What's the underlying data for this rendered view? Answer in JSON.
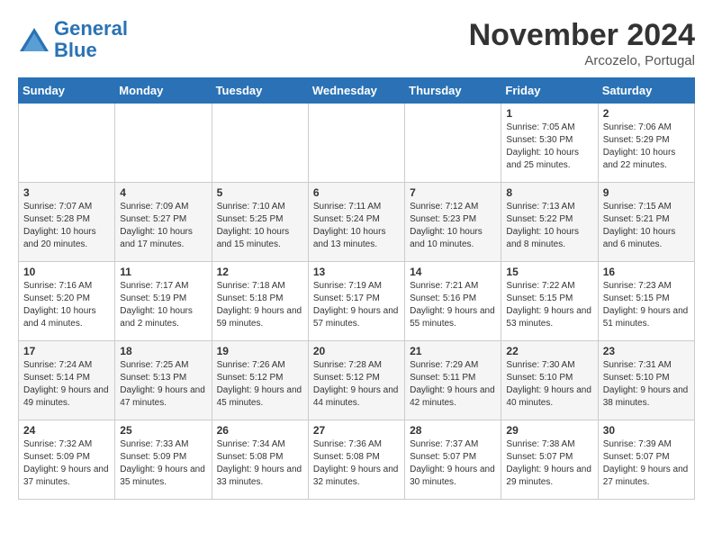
{
  "logo": {
    "line1": "General",
    "line2": "Blue"
  },
  "title": "November 2024",
  "location": "Arcozelo, Portugal",
  "weekdays": [
    "Sunday",
    "Monday",
    "Tuesday",
    "Wednesday",
    "Thursday",
    "Friday",
    "Saturday"
  ],
  "weeks": [
    [
      {
        "day": "",
        "content": ""
      },
      {
        "day": "",
        "content": ""
      },
      {
        "day": "",
        "content": ""
      },
      {
        "day": "",
        "content": ""
      },
      {
        "day": "",
        "content": ""
      },
      {
        "day": "1",
        "content": "Sunrise: 7:05 AM\nSunset: 5:30 PM\nDaylight: 10 hours and 25 minutes."
      },
      {
        "day": "2",
        "content": "Sunrise: 7:06 AM\nSunset: 5:29 PM\nDaylight: 10 hours and 22 minutes."
      }
    ],
    [
      {
        "day": "3",
        "content": "Sunrise: 7:07 AM\nSunset: 5:28 PM\nDaylight: 10 hours and 20 minutes."
      },
      {
        "day": "4",
        "content": "Sunrise: 7:09 AM\nSunset: 5:27 PM\nDaylight: 10 hours and 17 minutes."
      },
      {
        "day": "5",
        "content": "Sunrise: 7:10 AM\nSunset: 5:25 PM\nDaylight: 10 hours and 15 minutes."
      },
      {
        "day": "6",
        "content": "Sunrise: 7:11 AM\nSunset: 5:24 PM\nDaylight: 10 hours and 13 minutes."
      },
      {
        "day": "7",
        "content": "Sunrise: 7:12 AM\nSunset: 5:23 PM\nDaylight: 10 hours and 10 minutes."
      },
      {
        "day": "8",
        "content": "Sunrise: 7:13 AM\nSunset: 5:22 PM\nDaylight: 10 hours and 8 minutes."
      },
      {
        "day": "9",
        "content": "Sunrise: 7:15 AM\nSunset: 5:21 PM\nDaylight: 10 hours and 6 minutes."
      }
    ],
    [
      {
        "day": "10",
        "content": "Sunrise: 7:16 AM\nSunset: 5:20 PM\nDaylight: 10 hours and 4 minutes."
      },
      {
        "day": "11",
        "content": "Sunrise: 7:17 AM\nSunset: 5:19 PM\nDaylight: 10 hours and 2 minutes."
      },
      {
        "day": "12",
        "content": "Sunrise: 7:18 AM\nSunset: 5:18 PM\nDaylight: 9 hours and 59 minutes."
      },
      {
        "day": "13",
        "content": "Sunrise: 7:19 AM\nSunset: 5:17 PM\nDaylight: 9 hours and 57 minutes."
      },
      {
        "day": "14",
        "content": "Sunrise: 7:21 AM\nSunset: 5:16 PM\nDaylight: 9 hours and 55 minutes."
      },
      {
        "day": "15",
        "content": "Sunrise: 7:22 AM\nSunset: 5:15 PM\nDaylight: 9 hours and 53 minutes."
      },
      {
        "day": "16",
        "content": "Sunrise: 7:23 AM\nSunset: 5:15 PM\nDaylight: 9 hours and 51 minutes."
      }
    ],
    [
      {
        "day": "17",
        "content": "Sunrise: 7:24 AM\nSunset: 5:14 PM\nDaylight: 9 hours and 49 minutes."
      },
      {
        "day": "18",
        "content": "Sunrise: 7:25 AM\nSunset: 5:13 PM\nDaylight: 9 hours and 47 minutes."
      },
      {
        "day": "19",
        "content": "Sunrise: 7:26 AM\nSunset: 5:12 PM\nDaylight: 9 hours and 45 minutes."
      },
      {
        "day": "20",
        "content": "Sunrise: 7:28 AM\nSunset: 5:12 PM\nDaylight: 9 hours and 44 minutes."
      },
      {
        "day": "21",
        "content": "Sunrise: 7:29 AM\nSunset: 5:11 PM\nDaylight: 9 hours and 42 minutes."
      },
      {
        "day": "22",
        "content": "Sunrise: 7:30 AM\nSunset: 5:10 PM\nDaylight: 9 hours and 40 minutes."
      },
      {
        "day": "23",
        "content": "Sunrise: 7:31 AM\nSunset: 5:10 PM\nDaylight: 9 hours and 38 minutes."
      }
    ],
    [
      {
        "day": "24",
        "content": "Sunrise: 7:32 AM\nSunset: 5:09 PM\nDaylight: 9 hours and 37 minutes."
      },
      {
        "day": "25",
        "content": "Sunrise: 7:33 AM\nSunset: 5:09 PM\nDaylight: 9 hours and 35 minutes."
      },
      {
        "day": "26",
        "content": "Sunrise: 7:34 AM\nSunset: 5:08 PM\nDaylight: 9 hours and 33 minutes."
      },
      {
        "day": "27",
        "content": "Sunrise: 7:36 AM\nSunset: 5:08 PM\nDaylight: 9 hours and 32 minutes."
      },
      {
        "day": "28",
        "content": "Sunrise: 7:37 AM\nSunset: 5:07 PM\nDaylight: 9 hours and 30 minutes."
      },
      {
        "day": "29",
        "content": "Sunrise: 7:38 AM\nSunset: 5:07 PM\nDaylight: 9 hours and 29 minutes."
      },
      {
        "day": "30",
        "content": "Sunrise: 7:39 AM\nSunset: 5:07 PM\nDaylight: 9 hours and 27 minutes."
      }
    ]
  ]
}
